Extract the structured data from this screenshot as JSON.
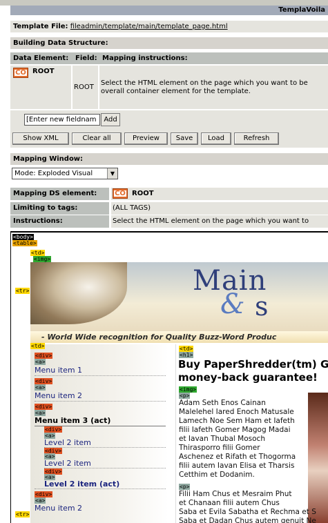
{
  "app": {
    "title": "TemplaVoila"
  },
  "template_file": {
    "label": "Template File:",
    "path": "fileadmin/template/main/template_page.html"
  },
  "building": {
    "title": "Building Data Structure:"
  },
  "ds_table": {
    "headers": [
      "Data Element:",
      "Field:",
      "Mapping instructions:"
    ],
    "root": {
      "icon": "co-icon",
      "icon_text": "CO",
      "name": "ROOT",
      "field": "ROOT",
      "instruction_line1": "Select the HTML element on the page which you want to be",
      "instruction_line2": "overall container element for the template."
    }
  },
  "new_field": {
    "placeholder": "[Enter new fieldnam",
    "add_label": "Add"
  },
  "toolbar": {
    "show_xml": "Show XML",
    "clear_all": "Clear all",
    "preview": "Preview",
    "save": "Save",
    "load": "Load",
    "refresh": "Refresh"
  },
  "mapping_window": {
    "title": "Mapping Window:",
    "mode": "Mode: Exploded Visual"
  },
  "mapping": {
    "ds_element_label": "Mapping DS element:",
    "ds_element_icon": "CO",
    "ds_element_value": "ROOT",
    "limiting_label": "Limiting to tags:",
    "limiting_value": "(ALL TAGS)",
    "instructions_label": "Instructions:",
    "instructions_value": "Select the HTML element on the page which you want to"
  },
  "preview": {
    "tags": {
      "body": "<body>",
      "table": "<table>",
      "tr": "<tr>",
      "td": "<td>",
      "img": "<img>",
      "div": "<div>",
      "a": "<a>",
      "h1": "<h1>",
      "p": "<p>"
    },
    "banner": {
      "main": "Main",
      "amp": "&",
      "s": "s",
      "tagline": "- World Wide recognition for Quality Buzz-Word Produc"
    },
    "menu": {
      "item1": "Menu item 1",
      "item2": "Menu item 2",
      "item3": "Menu item 3 (act)",
      "level2a": "Level 2 item",
      "level2b": "Level 2 item",
      "level2act": "Level 2 item (act)",
      "item4": "Menu item 2"
    },
    "headline_line1": "Buy PaperShredder(tm) Gi",
    "headline_line2": "money-back guarantee!",
    "para1": [
      "Adam Seth Enos Cainan",
      "Malelehel Iared Enoch Matusale",
      "Lamech Noe Sem Ham et Iafeth",
      "filii Iafeth Gomer Magog Madai",
      "et Iavan Thubal Mosoch",
      "Thirasporro filii Gomer",
      "Aschenez et Rifath et Thogorma",
      "filii autem Iavan Elisa et Tharsis",
      "Cetthim et Dodanim."
    ],
    "para2": [
      "Filii Ham Chus et Mesraim Phut",
      "et Chanaan filii autem Chus",
      "Saba et Evila Sabatha et Rechma et S",
      "Saba et Dadan Chus autem genuit Ne"
    ]
  }
}
